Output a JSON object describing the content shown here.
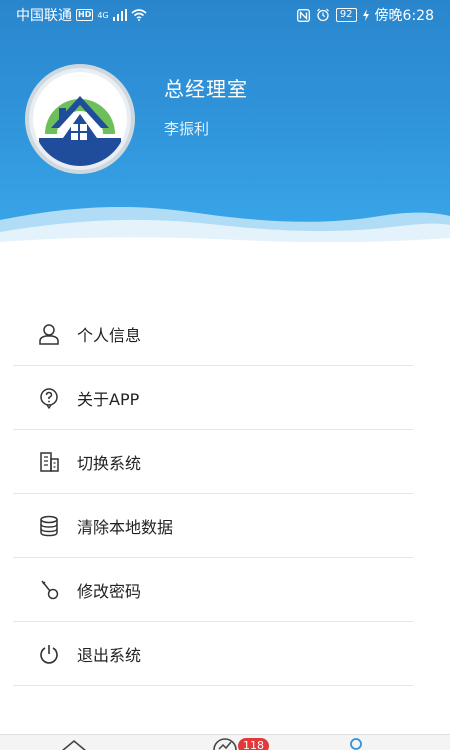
{
  "statusbar": {
    "carrier": "中国联通",
    "hd": "HD",
    "network": "4G",
    "battery": "92",
    "time": "傍晚6:28"
  },
  "profile": {
    "company": "总经理室",
    "username": "李振利"
  },
  "menu": {
    "items": [
      {
        "label": "个人信息",
        "icon": "person-icon"
      },
      {
        "label": "关于APP",
        "icon": "help-icon"
      },
      {
        "label": "切换系统",
        "icon": "building-icon"
      },
      {
        "label": "清除本地数据",
        "icon": "database-icon"
      },
      {
        "label": "修改密码",
        "icon": "key-icon"
      },
      {
        "label": "退出系统",
        "icon": "power-icon"
      }
    ]
  },
  "tabbar": {
    "badge_count": "118"
  },
  "colors": {
    "header_blue": "#2f93da",
    "badge_red": "#e23a3a"
  }
}
